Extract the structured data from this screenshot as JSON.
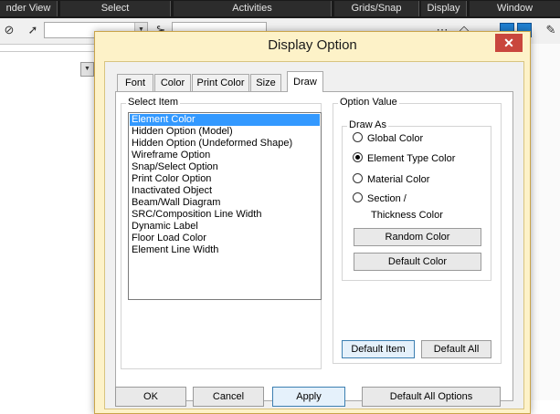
{
  "app": {
    "menu_tabs": [
      "nder View",
      "Select",
      "Activities",
      "Grids/Snap",
      "Display",
      "Window"
    ],
    "accent_blue": "#1f7fd0"
  },
  "dialog": {
    "title": "Display Option",
    "close_glyph": "✕",
    "tabs": [
      {
        "label": "Font",
        "active": false
      },
      {
        "label": "Color",
        "active": false
      },
      {
        "label": "Print Color",
        "active": false
      },
      {
        "label": "Size",
        "active": false
      },
      {
        "label": "Draw",
        "active": true
      }
    ],
    "select_item": {
      "label": "Select Item",
      "items": [
        "Element Color",
        "Hidden Option (Model)",
        "Hidden Option (Undeformed Shape)",
        "Wireframe Option",
        "Snap/Select Option",
        "Print Color Option",
        "Inactivated Object",
        "Beam/Wall Diagram",
        "SRC/Composition Line Width",
        "Dynamic Label",
        "Floor Load Color",
        "Element Line Width"
      ],
      "selected_index": 0
    },
    "option_value": {
      "label": "Option Value",
      "draw_as": {
        "label": "Draw As",
        "options": [
          {
            "label": "Global Color",
            "checked": false
          },
          {
            "label": "Element Type Color",
            "checked": true
          },
          {
            "label": "Material Color",
            "checked": false
          },
          {
            "label": "Section /",
            "checked": false
          }
        ],
        "section_second_line": "Thickness Color"
      },
      "random_color_label": "Random Color",
      "default_color_label": "Default Color"
    },
    "default_item_label": "Default Item",
    "default_all_label": "Default All",
    "footer": {
      "ok_label": "OK",
      "cancel_label": "Cancel",
      "apply_label": "Apply",
      "default_all_options_label": "Default All Options"
    }
  }
}
